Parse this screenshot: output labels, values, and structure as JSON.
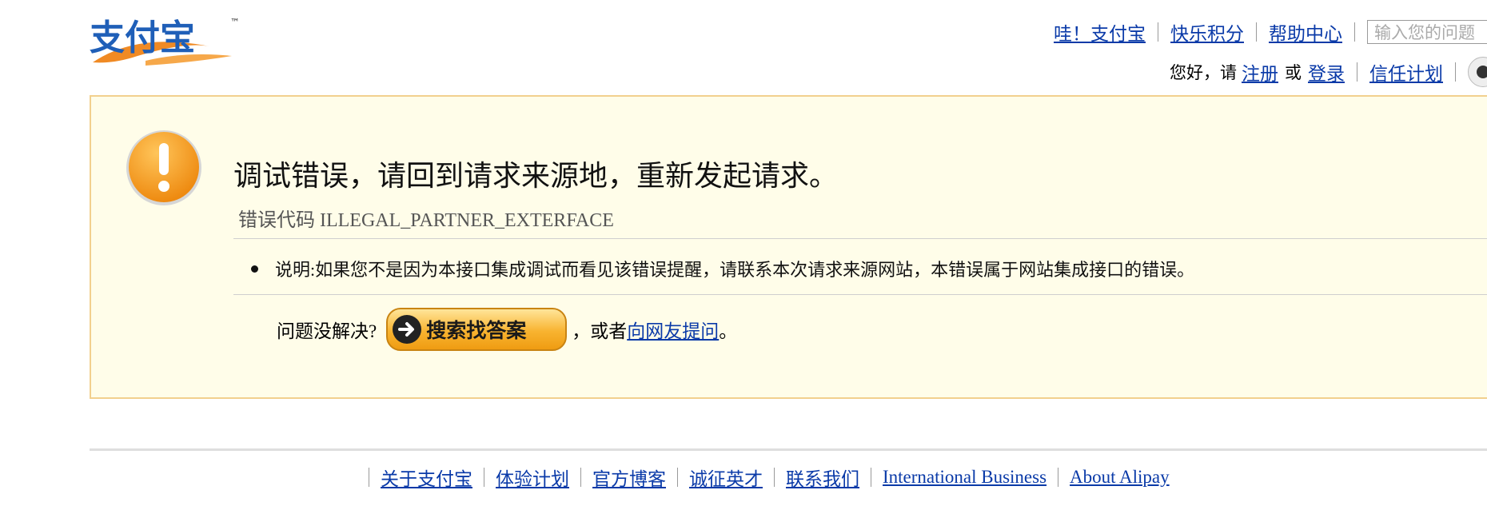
{
  "logo": {
    "text": "支付宝",
    "tm": "™"
  },
  "topnav": {
    "items": [
      "哇！支付宝",
      "快乐积分",
      "帮助中心"
    ],
    "search_placeholder": "输入您的问题"
  },
  "usernav": {
    "greeting": "您好，请",
    "register": "注册",
    "or": "或",
    "login": "登录",
    "trust": "信任计划"
  },
  "notice": {
    "title": "调试错误，请回到请求来源地，重新发起请求。",
    "error_code": "错误代码 ILLEGAL_PARTNER_EXTERFACE",
    "description": "说明:如果您不是因为本接口集成调试而看见该错误提醒，请联系本次请求来源网站，本错误属于网站集成接口的错误。",
    "ask_prefix": "问题没解决?",
    "search_button": "搜索找答案",
    "or_text": "，或者",
    "ask_link": "向网友提问",
    "period": "。"
  },
  "footer": {
    "links": [
      "关于支付宝",
      "体验计划",
      "官方博客",
      "诚征英才",
      "联系我们",
      "International Business",
      "About Alipay"
    ]
  },
  "colors": {
    "link": "#0a3aa8",
    "notice_bg": "#fffde9",
    "notice_border": "#f2d08e",
    "logo_blue": "#1f5fb8",
    "logo_orange": "#f08a24"
  }
}
